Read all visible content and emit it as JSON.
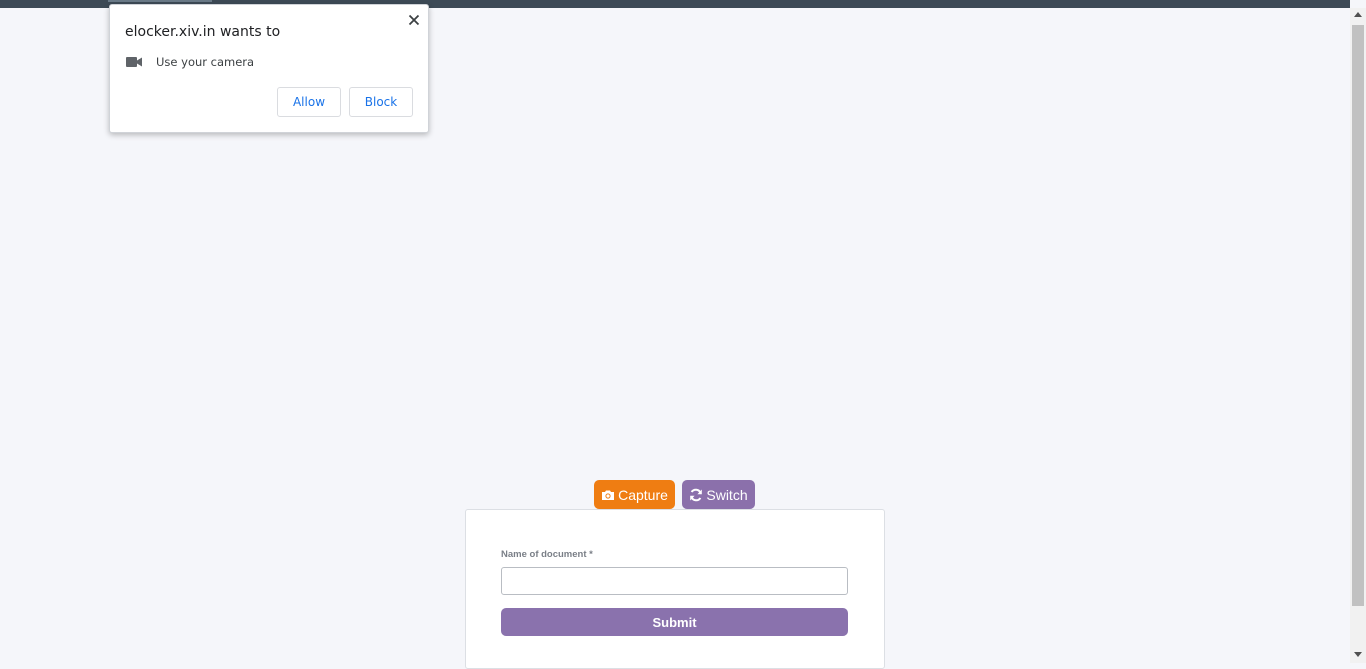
{
  "permission_prompt": {
    "title": "elocker.xiv.in wants to",
    "request": "Use your camera",
    "allow_label": "Allow",
    "block_label": "Block"
  },
  "camera_controls": {
    "capture_label": "Capture",
    "switch_label": "Switch"
  },
  "form": {
    "name_label": "Name of document *",
    "name_value": "",
    "name_placeholder": "",
    "submit_label": "Submit"
  },
  "colors": {
    "capture": "#ef7d12",
    "switch": "#8b70ab",
    "submit": "#8a72ad",
    "link_blue": "#1a73e8"
  }
}
